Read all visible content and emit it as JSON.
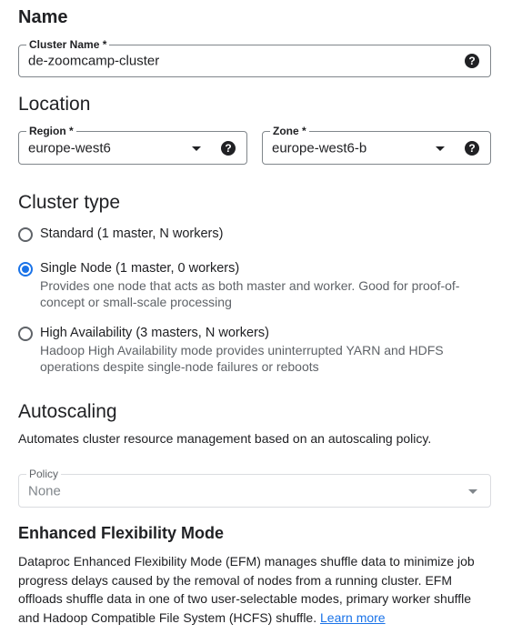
{
  "name_section": {
    "heading": "Name",
    "cluster_name": {
      "label": "Cluster Name *",
      "value": "de-zoomcamp-cluster",
      "help_icon": "help-icon"
    }
  },
  "location_section": {
    "heading": "Location",
    "region": {
      "label": "Region *",
      "value": "europe-west6",
      "dropdown_icon": "chevron-down-icon",
      "help_icon": "help-icon"
    },
    "zone": {
      "label": "Zone *",
      "value": "europe-west6-b",
      "dropdown_icon": "chevron-down-icon",
      "help_icon": "help-icon"
    }
  },
  "cluster_type_section": {
    "heading": "Cluster type",
    "options": [
      {
        "label": "Standard (1 master, N workers)",
        "description": "",
        "selected": false
      },
      {
        "label": "Single Node (1 master, 0 workers)",
        "description": "Provides one node that acts as both master and worker. Good for proof-of-concept or small-scale processing",
        "selected": true
      },
      {
        "label": "High Availability (3 masters, N workers)",
        "description": "Hadoop High Availability mode provides uninterrupted YARN and HDFS operations despite single-node failures or reboots",
        "selected": false
      }
    ]
  },
  "autoscaling_section": {
    "heading": "Autoscaling",
    "description": "Automates cluster resource management based on an autoscaling policy.",
    "policy": {
      "label": "Policy",
      "value": "None",
      "disabled": true
    }
  },
  "efm_section": {
    "heading": "Enhanced Flexibility Mode",
    "description": "Dataproc Enhanced Flexibility Mode (EFM) manages shuffle data to minimize job progress delays caused by the removal of nodes from a running cluster. EFM offloads shuffle data in one of two user-selectable modes, primary worker shuffle and Hadoop Compatible File System (HCFS) shuffle.",
    "link_text": "Learn more"
  },
  "colors": {
    "accent": "#1a73e8",
    "text_primary": "#202124",
    "text_secondary": "#5f6368",
    "border": "#80868b"
  }
}
